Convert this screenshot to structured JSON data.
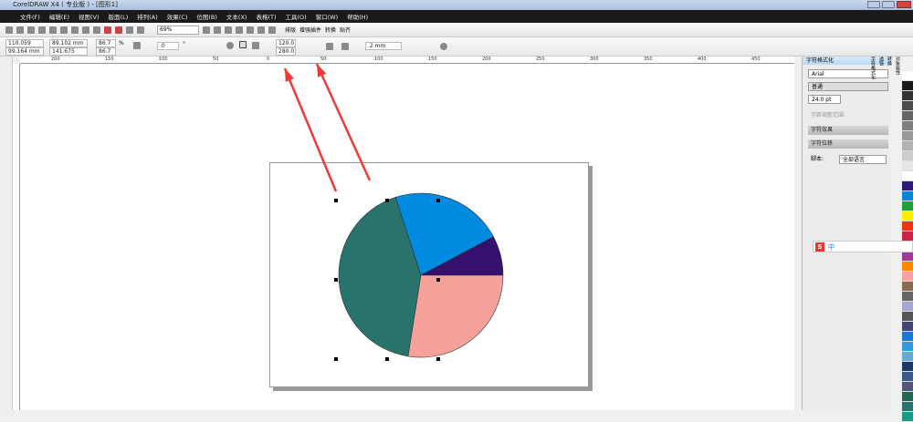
{
  "window": {
    "title": "CorelDRAW X4 ( 专业版 ) - [图形1]"
  },
  "menu": [
    "文件(F)",
    "编辑(E)",
    "视图(V)",
    "版面(L)",
    "排列(A)",
    "效果(C)",
    "位图(B)",
    "文本(X)",
    "表格(T)",
    "工具(O)",
    "窗口(W)",
    "帮助(H)"
  ],
  "toolbar": {
    "zoom": "69%",
    "buttons": [
      "排版",
      "增强插件",
      "转换",
      "贴齐"
    ]
  },
  "property_bar": {
    "x": "110.059 mm",
    "y": "99.164 mm",
    "width": "89.102 mm",
    "height": "141.675 mm",
    "scale_x": "86.7",
    "scale_y": "86.7",
    "pct": "%",
    "rotation": ".0",
    "deg": "°",
    "start_angle": "120.0",
    "end_angle": "280.0",
    "outline": ".2 mm"
  },
  "ruler": {
    "ticks": [
      "200",
      "150",
      "100",
      "50",
      "0",
      "50",
      "100",
      "150",
      "200",
      "250",
      "300",
      "350",
      "400",
      "450"
    ]
  },
  "docker": {
    "title": "字符格式化",
    "font": "Arial",
    "style": "普通",
    "size": "24.0 pt",
    "kerning_label": "字距调整范围:",
    "section1": "字符效果",
    "section2": "字符位移",
    "script_label": "脚本:",
    "script_value": "全部语言",
    "tabs": [
      "对象属性",
      "转换",
      "透镜",
      "字符格式化"
    ]
  },
  "ime": {
    "label": "中"
  },
  "pie": {
    "slices": [
      {
        "color": "#008ae0",
        "start": -108,
        "end": -28
      },
      {
        "color": "#35106e",
        "start": -28,
        "end": 0
      },
      {
        "color": "#f6a19a",
        "start": 0,
        "end": 99
      },
      {
        "color": "#28736b",
        "start": 99,
        "end": 252
      }
    ]
  },
  "annotation_color": "#f03a3a",
  "palette": [
    "#ffffff",
    "#1a1a1a",
    "#333",
    "#4d4d4d",
    "#666",
    "#808080",
    "#999",
    "#b3b3b3",
    "#ccc",
    "#e6e6e6",
    "#ffffff",
    "#2f1a78",
    "#0a84d8",
    "#1ea03c",
    "#ffee00",
    "#ee3311",
    "#cc2244",
    "#7a2a7a",
    "#9a3c9a",
    "#ff8800",
    "#ff9f9f",
    "#8a6a50",
    "#666",
    "#a6a6d0",
    "#555",
    "#447",
    "#2277cc",
    "#3399dd",
    "#66aacc",
    "#1a3a66",
    "#3a5a8a",
    "#555577",
    "#226655",
    "#28736b",
    "#1a9a88"
  ]
}
